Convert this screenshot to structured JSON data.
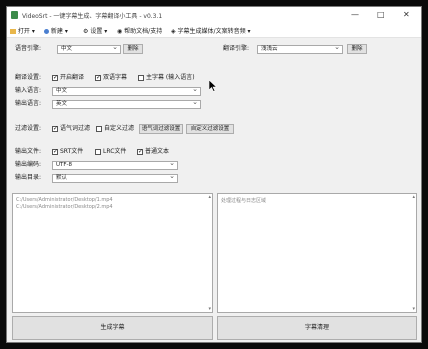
{
  "titlebar": {
    "title": "VideoSrt - 一键字幕生成、字幕翻译小工具 - v0.3.1",
    "minimize_glyph": "—",
    "maximize_glyph": "□",
    "close_glyph": "✕"
  },
  "menu": {
    "open_label": "打开",
    "new_label": "新建",
    "settings_label": "设置",
    "help_label": "帮助文档/支持",
    "media_label": "字幕生成媒体/文案转音频"
  },
  "speech": {
    "label": "语音引擎:",
    "value": "中文",
    "delete_label": "删除"
  },
  "translate_engine": {
    "label": "翻译引擎:",
    "value": "浅浅云",
    "delete_label": "删除"
  },
  "translate_settings": {
    "label": "翻译设置:",
    "enable_label": "开启翻译",
    "bilingual_label": "双语字幕",
    "main_sub_label": "主字幕 (输入语言)",
    "enable_checked": true,
    "bilingual_checked": true,
    "main_sub_checked": false
  },
  "input_lang": {
    "label": "输入语言:",
    "value": "中文"
  },
  "output_lang": {
    "label": "输出语言:",
    "value": "英文"
  },
  "filter": {
    "label": "过滤设置:",
    "mood_label": "语气词过滤",
    "custom_label": "自定义过滤",
    "mood_checked": true,
    "custom_checked": false,
    "mood_settings_label": "语气词过滤设置",
    "custom_settings_label": "自定义过滤设置"
  },
  "output_files": {
    "label": "输出文件:",
    "srt_label": "SRT文件",
    "lrc_label": "LRC文件",
    "txt_label": "普通文本",
    "srt_checked": true,
    "lrc_checked": false,
    "txt_checked": true
  },
  "encoding": {
    "label": "输出编码:",
    "value": "UTF-8"
  },
  "output_dir": {
    "label": "输出目录:",
    "value": "默认"
  },
  "files": {
    "line1": "C:/Users/Administrator/Desktop/1.mp4",
    "line2": "C:/Users/Administrator/Desktop/2.mp4"
  },
  "log": {
    "placeholder": "处理过程与日志区域"
  },
  "actions": {
    "generate_label": "生成字幕",
    "clear_label": "字幕清理"
  }
}
